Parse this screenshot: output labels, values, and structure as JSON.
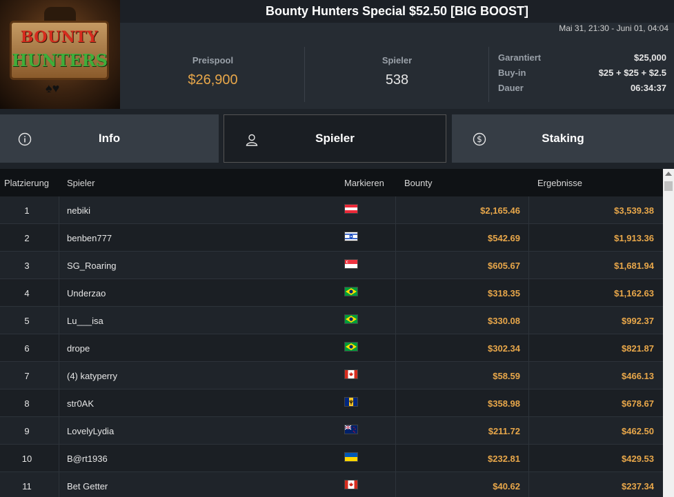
{
  "header": {
    "title": "Bounty Hunters Special $52.50 [BIG BOOST]",
    "date_range": "Mai 31, 21:30 - Juni 01, 04:04",
    "logo_text_1": "BOUNTY",
    "logo_text_2": "HUNTERS"
  },
  "stats": {
    "prizepool_label": "Preispool",
    "prizepool_value": "$26,900",
    "players_label": "Spieler",
    "players_value": "538"
  },
  "details": {
    "guaranteed_label": "Garantiert",
    "guaranteed_value": "$25,000",
    "buyin_label": "Buy-in",
    "buyin_value": "$25 + $25 + $2.5",
    "duration_label": "Dauer",
    "duration_value": "06:34:37"
  },
  "tabs": {
    "info": "Info",
    "players": "Spieler",
    "staking": "Staking"
  },
  "table": {
    "headers": {
      "rank": "Platzierung",
      "player": "Spieler",
      "mark": "Markieren",
      "bounty": "Bounty",
      "results": "Ergebnisse"
    },
    "rows": [
      {
        "rank": "1",
        "player": "nebiki",
        "flag": "austria",
        "bounty": "$2,165.46",
        "result": "$3,539.38"
      },
      {
        "rank": "2",
        "player": "benben777",
        "flag": "israel",
        "bounty": "$542.69",
        "result": "$1,913.36"
      },
      {
        "rank": "3",
        "player": "SG_Roaring",
        "flag": "singapore",
        "bounty": "$605.67",
        "result": "$1,681.94"
      },
      {
        "rank": "4",
        "player": "Underzao",
        "flag": "brazil",
        "bounty": "$318.35",
        "result": "$1,162.63"
      },
      {
        "rank": "5",
        "player": "Lu___isa",
        "flag": "brazil",
        "bounty": "$330.08",
        "result": "$992.37"
      },
      {
        "rank": "6",
        "player": "drope",
        "flag": "brazil",
        "bounty": "$302.34",
        "result": "$821.87"
      },
      {
        "rank": "7",
        "player": "(4) katyperry",
        "flag": "canada",
        "bounty": "$58.59",
        "result": "$466.13"
      },
      {
        "rank": "8",
        "player": "str0AK",
        "flag": "barbados",
        "bounty": "$358.98",
        "result": "$678.67"
      },
      {
        "rank": "9",
        "player": "LovelyLydia",
        "flag": "new-zealand",
        "bounty": "$211.72",
        "result": "$462.50"
      },
      {
        "rank": "10",
        "player": "B@rt1936",
        "flag": "ukraine",
        "bounty": "$232.81",
        "result": "$429.53"
      },
      {
        "rank": "11",
        "player": "Bet Getter",
        "flag": "canada",
        "bounty": "$40.62",
        "result": "$237.34"
      }
    ]
  },
  "colors": {
    "accent_gold": "#e8a74a"
  }
}
